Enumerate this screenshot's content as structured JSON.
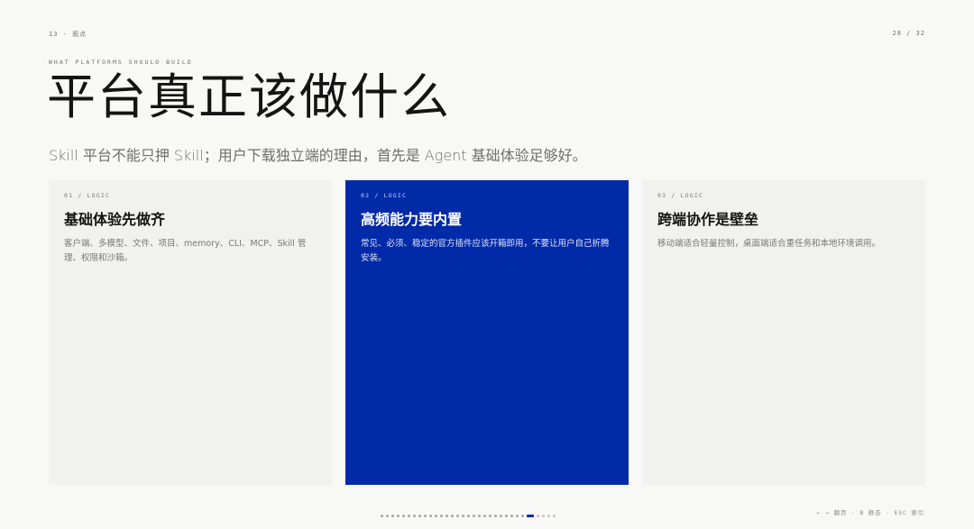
{
  "header": {
    "section": "13 · 观点",
    "page": "28 / 32"
  },
  "slide": {
    "eyebrow": "WHAT PLATFORMS SHOULD BUILD",
    "title": "平台真正该做什么",
    "subtitle": "Skill 平台不能只押 Skill；用户下载独立端的理由，首先是 Agent 基础体验足够好。"
  },
  "cards": [
    {
      "tag": "01 / LOGIC",
      "title": "基础体验先做齐",
      "desc": "客户端、多模型、文件、项目、memory、CLI、MCP、Skill 管理、权限和沙箱。",
      "active": false
    },
    {
      "tag": "02 / LOGIC",
      "title": "高频能力要内置",
      "desc": "常见、必须、稳定的官方插件应该开箱即用，不要让用户自己折腾安装。",
      "active": true
    },
    {
      "tag": "03 / LOGIC",
      "title": "跨端协作是壁垒",
      "desc": "移动端适合轻量控制，桌面端适合重任务和本地环境调用。",
      "active": false
    }
  ],
  "nav": {
    "total_slides": 32,
    "current_slide": 28,
    "hint": "← → 翻页 · B 静态 · ESC 索引"
  },
  "colors": {
    "accent": "#012aa8",
    "background": "#f8f8f6",
    "card": "#f1f1f0"
  }
}
